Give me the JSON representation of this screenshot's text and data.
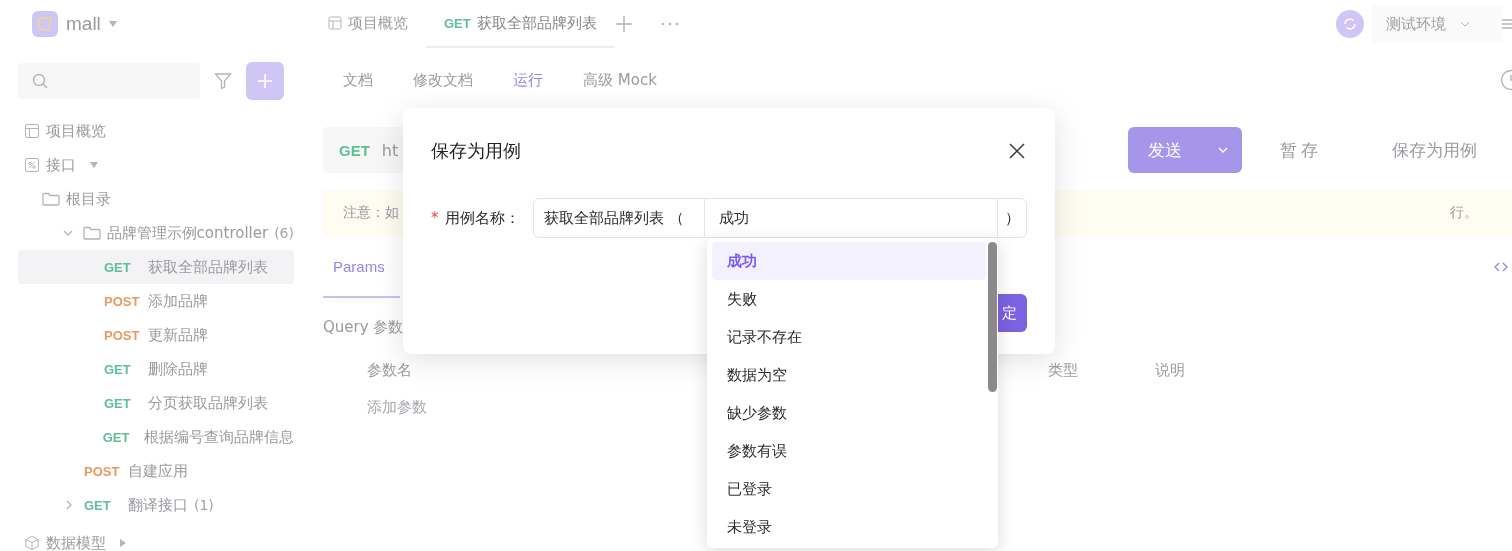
{
  "app": {
    "project": "mall"
  },
  "top_tabs": [
    {
      "kind": "overview",
      "label": "项目概览",
      "selected": false
    },
    {
      "kind": "api",
      "method": "GET",
      "label": "获取全部品牌列表",
      "selected": true
    }
  ],
  "environment": "测试环境",
  "sidebar": {
    "items": [
      {
        "kind": "overview",
        "label": "项目概览"
      },
      {
        "kind": "section",
        "label": "接口",
        "expanded": true,
        "children": [
          {
            "kind": "root",
            "label": "根目录"
          },
          {
            "kind": "folder",
            "label": "品牌管理示例controller",
            "count": "(6)",
            "expanded": true,
            "children": [
              {
                "kind": "api",
                "method": "GET",
                "label": "获取全部品牌列表",
                "selected": true
              },
              {
                "kind": "api",
                "method": "POST",
                "label": "添加品牌",
                "selected": false
              },
              {
                "kind": "api",
                "method": "POST",
                "label": "更新品牌",
                "selected": false
              },
              {
                "kind": "api",
                "method": "GET",
                "label": "删除品牌",
                "selected": false
              },
              {
                "kind": "api",
                "method": "GET",
                "label": "分页获取品牌列表",
                "selected": false
              },
              {
                "kind": "api",
                "method": "GET",
                "label": "根据编号查询品牌信息",
                "selected": false
              }
            ]
          },
          {
            "kind": "api",
            "method": "POST",
            "label": "自建应用",
            "selected": false
          },
          {
            "kind": "api",
            "method": "GET",
            "label": "翻译接口",
            "count": "(1)",
            "expanded": false,
            "selected": false
          }
        ]
      },
      {
        "kind": "section",
        "label": "数据模型",
        "expanded": false
      }
    ]
  },
  "subtabs": [
    {
      "label": "文档",
      "selected": false
    },
    {
      "label": "修改文档",
      "selected": false
    },
    {
      "label": "运行",
      "selected": true
    },
    {
      "label": "高级 Mock",
      "selected": false
    }
  ],
  "request": {
    "method": "GET",
    "url": "ht",
    "send": "发送",
    "save_draft": "暂存",
    "save_case": "保存为用例"
  },
  "notice": {
    "start": "注意：如",
    "end": "行。"
  },
  "params": {
    "tab": "Params",
    "section": "Query 参数",
    "columns": [
      "参数名",
      "类型",
      "说明"
    ],
    "add": "添加参数"
  },
  "dialog": {
    "title": "保存为用例",
    "required_mark": "*",
    "label": "用例名称：",
    "prefix": "获取全部品牌列表 （",
    "value": "成功",
    "suffix": "）",
    "confirm": "定"
  },
  "dropdown": [
    {
      "label": "成功",
      "selected": true
    },
    {
      "label": "失败",
      "selected": false
    },
    {
      "label": "记录不存在",
      "selected": false
    },
    {
      "label": "数据为空",
      "selected": false
    },
    {
      "label": "缺少参数",
      "selected": false
    },
    {
      "label": "参数有误",
      "selected": false
    },
    {
      "label": "已登录",
      "selected": false
    },
    {
      "label": "未登录",
      "selected": false
    }
  ]
}
